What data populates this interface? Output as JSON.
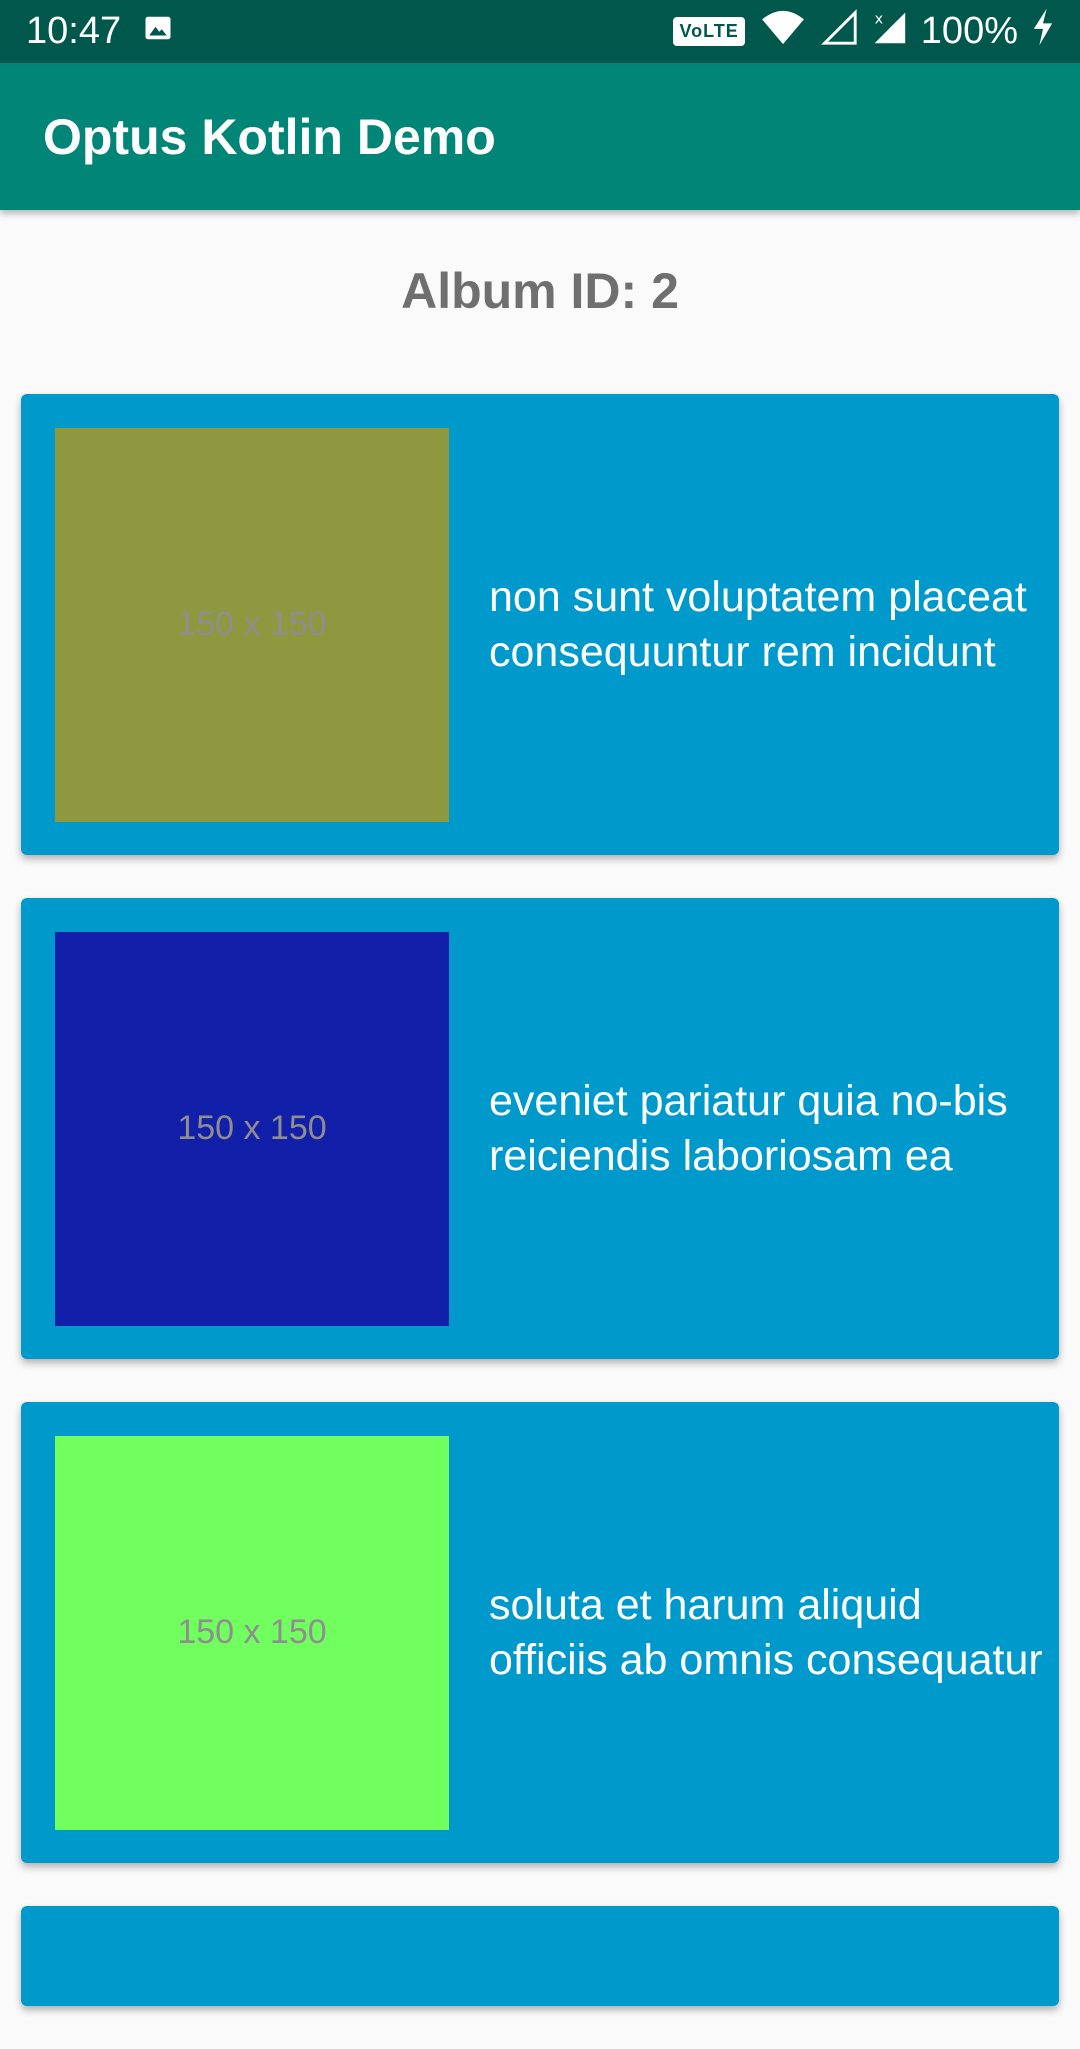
{
  "status_bar": {
    "time": "10:47",
    "volte": "VoLTE",
    "battery": "100%",
    "icons": [
      "image-icon",
      "wifi-icon",
      "signal-icon",
      "signal-no-data-icon",
      "battery-charging-icon"
    ]
  },
  "app_bar": {
    "title": "Optus Kotlin Demo"
  },
  "album_header": "Album ID: 2",
  "photos": [
    {
      "title": "non sunt voluptatem placeat consequuntur rem incidunt",
      "thumb_label": "150 x 150",
      "color": "#8e983f"
    },
    {
      "title": "eveniet pariatur quia no-bis reiciendis laboriosam ea",
      "thumb_label": "150 x 150",
      "color": "#121fa8"
    },
    {
      "title": "soluta et harum aliquid officiis ab omnis consequatur",
      "thumb_label": "150 x 150",
      "color": "#71ff5f"
    }
  ],
  "colors": {
    "status_bar": "#00574b",
    "app_bar": "#008577",
    "card": "#0099cc",
    "background": "#fafafa"
  }
}
